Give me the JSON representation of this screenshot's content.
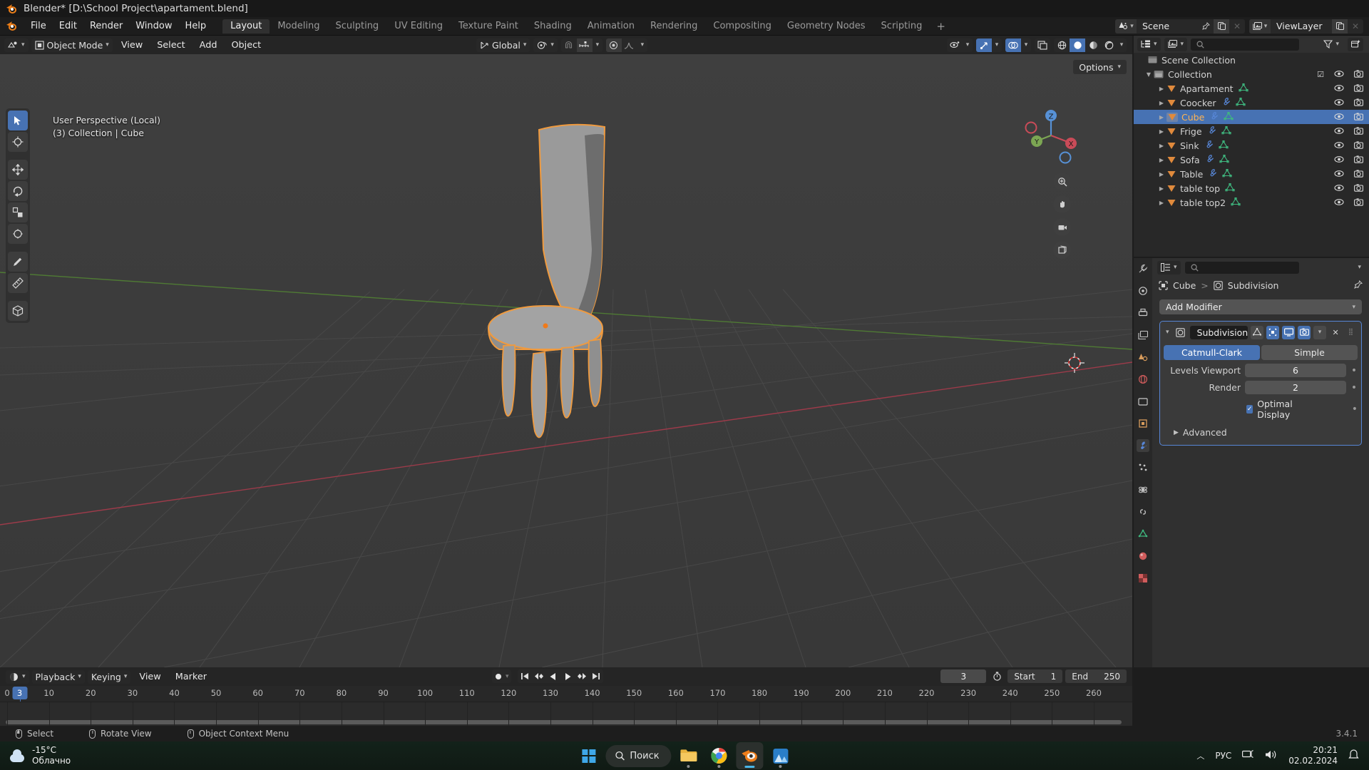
{
  "window": {
    "title": "Blender* [D:\\School Project\\apartament.blend]",
    "logo_icon": "blender-logo-icon"
  },
  "topbar": {
    "menus": [
      "File",
      "Edit",
      "Render",
      "Window",
      "Help"
    ],
    "workspaces": [
      "Layout",
      "Modeling",
      "Sculpting",
      "UV Editing",
      "Texture Paint",
      "Shading",
      "Animation",
      "Rendering",
      "Compositing",
      "Geometry Nodes",
      "Scripting"
    ],
    "active_workspace": "Layout",
    "add_workspace_label": "+",
    "scene": {
      "icon": "scene-icon",
      "name": "Scene",
      "pin_icon": "pin-icon",
      "copy_icon": "duplicate-icon",
      "close_icon": "close-icon"
    },
    "view_layer": {
      "icon": "view-layer-icon",
      "name": "ViewLayer",
      "copy_icon": "duplicate-icon",
      "close_icon": "close-icon"
    }
  },
  "viewport": {
    "mode": "Object Mode",
    "mode_icon": "object-mode-icon",
    "editor_icon": "editor-type-icon",
    "menus": [
      "View",
      "Select",
      "Add",
      "Object"
    ],
    "transform_orientation": "Global",
    "transform_icon": "orientation-icon",
    "pivot_icon": "pivot-point-icon",
    "snap_magnet_icon": "snap-magnet-icon",
    "snap_icon": "snap-increment-icon",
    "proportional_icon": "proportional-edit-icon",
    "falloff_icon": "falloff-curve-icon",
    "options_label": "Options",
    "visibility_icon": "visibility-icon",
    "gizmo_icon": "gizmo-icon",
    "overlays_icon": "overlays-icon",
    "xray_icon": "xray-icon",
    "shading_modes": [
      "wireframe-icon",
      "solid-icon",
      "material-preview-icon",
      "rendered-icon"
    ],
    "active_shading": "solid-icon",
    "overlay_text_line1": "User Perspective (Local)",
    "overlay_text_line2": "(3) Collection | Cube",
    "tools": [
      {
        "name": "tweak-tool",
        "icon": "cursor-arrow-icon",
        "active": true
      },
      {
        "name": "cursor-tool",
        "icon": "3d-cursor-icon",
        "active": false
      },
      {
        "name": "move-tool",
        "icon": "move-icon",
        "active": false
      },
      {
        "name": "rotate-tool",
        "icon": "rotate-icon",
        "active": false
      },
      {
        "name": "scale-tool",
        "icon": "scale-icon",
        "active": false
      },
      {
        "name": "transform-tool",
        "icon": "transform-icon",
        "active": false
      },
      {
        "name": "annotate-tool",
        "icon": "pencil-icon",
        "active": false
      },
      {
        "name": "measure-tool",
        "icon": "ruler-icon",
        "active": false
      },
      {
        "name": "add-cube-tool",
        "icon": "add-cube-icon",
        "active": false
      }
    ],
    "gizmo_axes": [
      "X",
      "Y",
      "Z"
    ],
    "nav_buttons": [
      "zoom-icon",
      "pan-hand-icon",
      "camera-icon",
      "ortho-persp-icon"
    ]
  },
  "outliner": {
    "display_mode_icon": "outliner-display-icon",
    "filter_icon": "filter-icon",
    "new_collection_icon": "new-collection-icon",
    "search_placeholder": "",
    "search_icon": "search-icon",
    "root": "Scene Collection",
    "collection": "Collection",
    "objects": [
      {
        "name": "Apartament",
        "has_modifier": false,
        "selected": false
      },
      {
        "name": "Coocker",
        "has_modifier": true,
        "selected": false
      },
      {
        "name": "Cube",
        "has_modifier": true,
        "selected": true
      },
      {
        "name": "Frige",
        "has_modifier": true,
        "selected": false
      },
      {
        "name": "Sink",
        "has_modifier": true,
        "selected": false
      },
      {
        "name": "Sofa",
        "has_modifier": true,
        "selected": false
      },
      {
        "name": "Table",
        "has_modifier": true,
        "selected": false
      },
      {
        "name": "table top",
        "has_modifier": false,
        "selected": false
      },
      {
        "name": "table top2",
        "has_modifier": false,
        "selected": false
      }
    ],
    "eye_icon": "eye-icon",
    "camera_icon": "render-visibility-icon",
    "checkbox_icon": "checkbox-icon"
  },
  "properties": {
    "search_icon": "search-icon",
    "editor_icon": "properties-editor-icon",
    "breadcrumb": {
      "object_icon": "object-data-icon",
      "object": "Cube",
      "separator": ">",
      "modifier_icon": "modifier-icon",
      "modifier": "Subdivision"
    },
    "pin_icon": "pin-icon",
    "add_modifier_label": "Add Modifier",
    "add_modifier_chevron": "chevron-down-icon",
    "modifier": {
      "expand_icon": "chevron-down-icon",
      "type_icon": "subdivision-icon",
      "name": "Subdivision",
      "toggles": [
        {
          "name": "on-cage-toggle",
          "icon": "on-cage-icon",
          "on": false
        },
        {
          "name": "edit-mode-toggle",
          "icon": "edit-mode-icon",
          "on": true
        },
        {
          "name": "realtime-toggle",
          "icon": "display-icon",
          "on": true
        },
        {
          "name": "render-toggle",
          "icon": "camera-icon",
          "on": true
        }
      ],
      "extras_icon": "chevron-down-icon",
      "delete_icon": "x-icon",
      "drag_icon": "drag-handle-icon",
      "subdiv_types": [
        "Catmull-Clark",
        "Simple"
      ],
      "active_subdiv_type": "Catmull-Clark",
      "rows": [
        {
          "label": "Levels Viewport",
          "value": "6"
        },
        {
          "label": "Render",
          "value": "2"
        }
      ],
      "optimal_display_label": "Optimal Display",
      "optimal_display_checked": true,
      "advanced_label": "Advanced",
      "advanced_icon": "chevron-right-icon"
    },
    "tabs": [
      {
        "name": "tool-tab",
        "icon": "tool-icon",
        "color": "#b8b8b8"
      },
      {
        "name": "render-tab",
        "icon": "render-icon",
        "color": "#c8c8c8"
      },
      {
        "name": "output-tab",
        "icon": "printer-icon",
        "color": "#c8c8c8"
      },
      {
        "name": "view-layer-tab",
        "icon": "images-icon",
        "color": "#c8c8c8"
      },
      {
        "name": "scene-tab",
        "icon": "scene-cone-icon",
        "color": "#d89c5c"
      },
      {
        "name": "world-tab",
        "icon": "world-icon",
        "color": "#d05c5c"
      },
      {
        "name": "collection-tab",
        "icon": "collection-icon",
        "color": "#c8c8c8"
      },
      {
        "name": "object-tab",
        "icon": "object-square-icon",
        "color": "#d89c5c"
      },
      {
        "name": "modifiers-tab",
        "icon": "wrench-icon",
        "color": "#5786d6"
      },
      {
        "name": "particles-tab",
        "icon": "particles-icon",
        "color": "#c8c8c8"
      },
      {
        "name": "physics-tab",
        "icon": "physics-icon",
        "color": "#c8c8c8"
      },
      {
        "name": "constraints-tab",
        "icon": "constraint-icon",
        "color": "#c8c8c8"
      },
      {
        "name": "data-tab",
        "icon": "mesh-data-icon",
        "color": "#3fb87f"
      },
      {
        "name": "material-tab",
        "icon": "material-sphere-icon",
        "color": "#d05c5c"
      },
      {
        "name": "texture-tab",
        "icon": "checker-icon",
        "color": "#d05c5c"
      }
    ]
  },
  "timeline": {
    "editor_icon": "timeline-editor-icon",
    "menus": [
      "Playback",
      "Keying",
      "View",
      "Marker"
    ],
    "record_icon": "record-icon",
    "transport": [
      "jump-start-icon",
      "prev-keyframe-icon",
      "play-reverse-icon",
      "play-icon",
      "next-keyframe-icon",
      "jump-end-icon"
    ],
    "current_frame": "3",
    "autokey_icon": "auto-keying-icon",
    "start_label": "Start",
    "start_value": "1",
    "end_label": "End",
    "end_value": "250",
    "ticks": [
      0,
      10,
      20,
      30,
      40,
      50,
      60,
      70,
      80,
      90,
      100,
      110,
      120,
      130,
      140,
      150,
      160,
      170,
      180,
      190,
      200,
      210,
      220,
      230,
      240,
      250,
      260
    ],
    "playhead_frame": 3
  },
  "statusbar": {
    "items": [
      {
        "icon": "mouse-left-icon",
        "label": "Select"
      },
      {
        "icon": "mouse-middle-icon",
        "label": "Rotate View"
      },
      {
        "icon": "mouse-right-icon",
        "label": "Object Context Menu"
      }
    ],
    "version": "3.4.1"
  },
  "taskbar": {
    "weather_temp": "-15°C",
    "weather_desc": "Облачно",
    "weather_icon": "cloud-icon",
    "start_icon": "windows-start-icon",
    "search_label": "Поиск",
    "search_icon": "search-icon",
    "apps": [
      {
        "name": "file-explorer-app",
        "icon": "folder-icon",
        "active": false
      },
      {
        "name": "chrome-app",
        "icon": "chrome-icon",
        "active": false
      },
      {
        "name": "blender-app",
        "icon": "blender-icon",
        "active": true
      },
      {
        "name": "photos-app",
        "icon": "photos-icon",
        "active": false
      }
    ],
    "tray": {
      "chevron_icon": "chevron-up-icon",
      "language": "РУС",
      "network_icon": "network-icon",
      "volume_icon": "volume-icon",
      "time": "20:21",
      "date": "02.02.2024",
      "notification_icon": "bell-icon"
    }
  },
  "colors": {
    "accent_blue": "#4772b3",
    "selected_orange": "#ffb454",
    "viewport_bg": "#3b3b3b",
    "panel_bg": "#303030",
    "outliner_bg": "#282828"
  }
}
